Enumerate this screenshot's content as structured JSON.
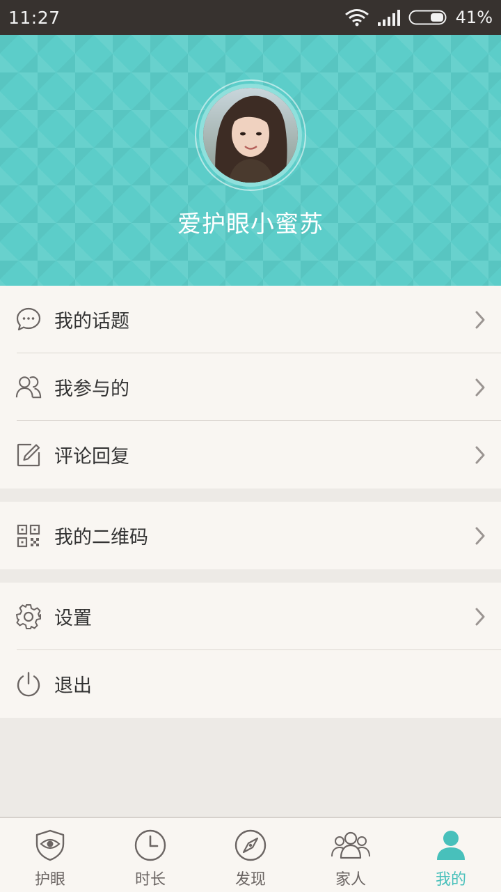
{
  "status_bar": {
    "time": "11:27",
    "battery": "41%",
    "battery_level": 0.41
  },
  "profile": {
    "name": "爱护眼小蜜苏"
  },
  "menu": {
    "group1": [
      {
        "label": "我的话题",
        "icon": "chat-bubble-icon"
      },
      {
        "label": "我参与的",
        "icon": "people-icon"
      },
      {
        "label": "评论回复",
        "icon": "edit-icon"
      }
    ],
    "group2": [
      {
        "label": "我的二维码",
        "icon": "qr-code-icon"
      }
    ],
    "group3": [
      {
        "label": "设置",
        "icon": "gear-icon"
      },
      {
        "label": "退出",
        "icon": "power-icon"
      }
    ]
  },
  "tabs": [
    {
      "label": "护眼",
      "icon": "eye-shield-icon"
    },
    {
      "label": "时长",
      "icon": "clock-icon"
    },
    {
      "label": "发现",
      "icon": "compass-icon"
    },
    {
      "label": "家人",
      "icon": "family-icon"
    },
    {
      "label": "我的",
      "icon": "person-icon",
      "active": true
    }
  ],
  "colors": {
    "accent": "#48c0bb",
    "header": "#5ccdc9",
    "status_bar": "#37322f",
    "icon_gray": "#6b6563"
  }
}
